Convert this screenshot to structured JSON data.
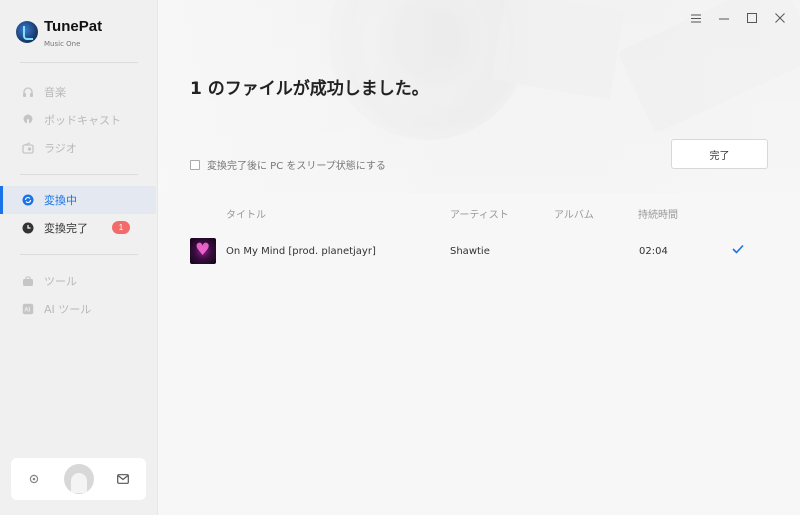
{
  "app": {
    "name": "TunePat",
    "subtitle": "Music One"
  },
  "sidebar": {
    "items": [
      {
        "label": "音楽",
        "icon": "headphones-icon",
        "state": "disabled"
      },
      {
        "label": "ポッドキャスト",
        "icon": "podcast-icon",
        "state": "disabled"
      },
      {
        "label": "ラジオ",
        "icon": "radio-icon",
        "state": "disabled"
      },
      {
        "label": "変換中",
        "icon": "converting-icon",
        "state": "active"
      },
      {
        "label": "変換完了",
        "icon": "clock-icon",
        "state": "normal",
        "badge": "1"
      },
      {
        "label": "ツール",
        "icon": "toolbox-icon",
        "state": "disabled"
      },
      {
        "label": "AI ツール",
        "icon": "ai-icon",
        "state": "disabled"
      }
    ],
    "bottom": {
      "settings_icon": "gear-icon",
      "avatar": "avatar",
      "mail_icon": "mail-icon"
    }
  },
  "window": {
    "controls": [
      "menu-icon",
      "minimize-icon",
      "maximize-icon",
      "close-icon"
    ]
  },
  "main": {
    "headline": "1 のファイルが成功しました。",
    "sleep_option": "変換完了後に PC をスリープ状態にする",
    "done_button": "完了",
    "table": {
      "columns": {
        "title": "タイトル",
        "artist": "アーティスト",
        "album": "アルバム",
        "duration": "持続時間"
      },
      "rows": [
        {
          "title": "On My Mind [prod. planetjayr]",
          "artist": "Shawtie",
          "album": "",
          "duration": "02:04",
          "status": "done"
        }
      ]
    }
  },
  "colors": {
    "accent": "#1a73e8",
    "badge": "#f26b6b"
  }
}
